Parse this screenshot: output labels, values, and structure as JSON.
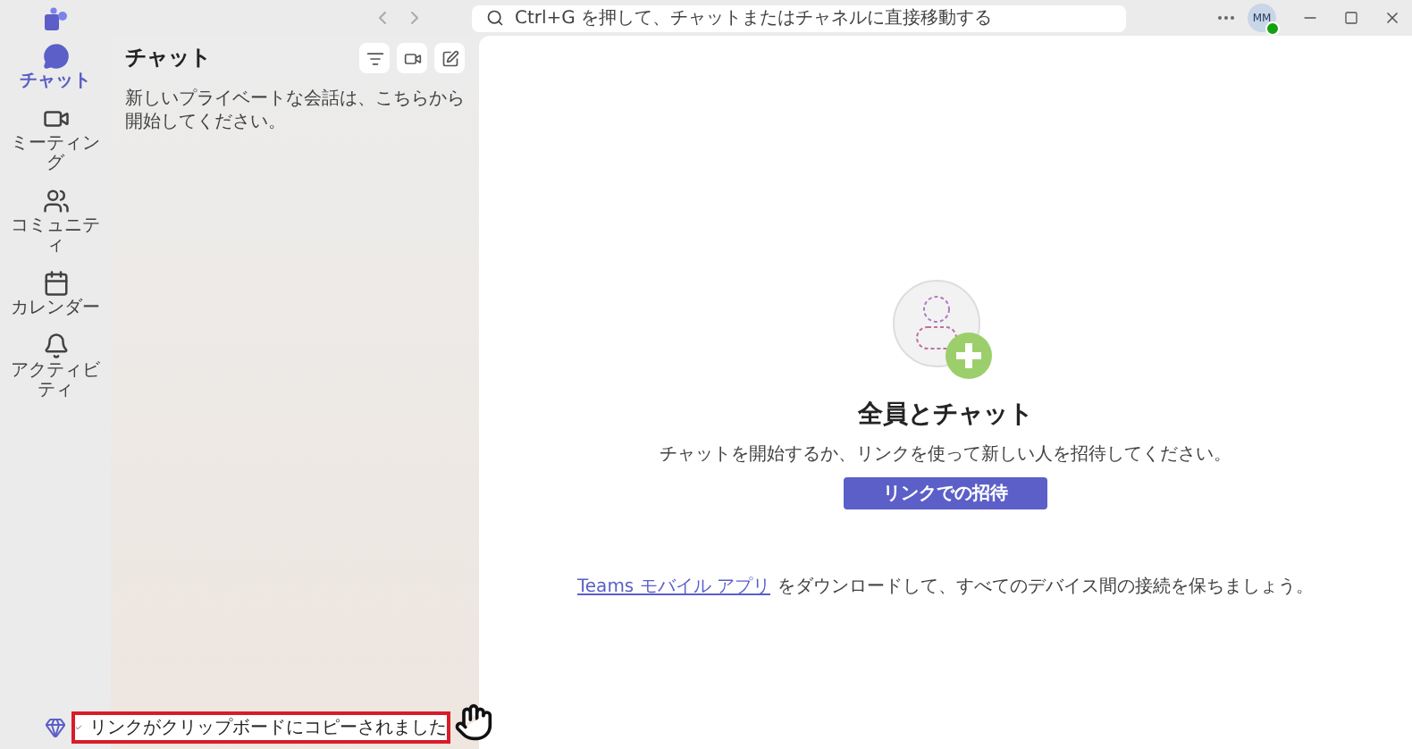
{
  "titlebar": {
    "search_placeholder": "Ctrl+G を押して、チャットまたはチャネルに直接移動する",
    "avatar_initials": "MM"
  },
  "nav": [
    {
      "label": "チャット",
      "selected": true
    },
    {
      "label": "ミーティング",
      "selected": false
    },
    {
      "label": "コミュニティ",
      "selected": false
    },
    {
      "label": "カレンダー",
      "selected": false
    },
    {
      "label": "アクティビティ",
      "selected": false
    }
  ],
  "chat_panel": {
    "title": "チャット",
    "hint": "新しいプライベートな会話は、こちらから開始してください。"
  },
  "main": {
    "title": "全員とチャット",
    "description": "チャットを開始するか、リンクを使って新しい人を招待してください。",
    "button": "リンクでの招待",
    "footer_link": "Teams モバイル アプリ",
    "footer_text": "をダウンロードして、すべてのデバイス間の接続を保ちましょう。"
  },
  "toast": {
    "message": "リンクがクリップボードにコピーされました"
  }
}
